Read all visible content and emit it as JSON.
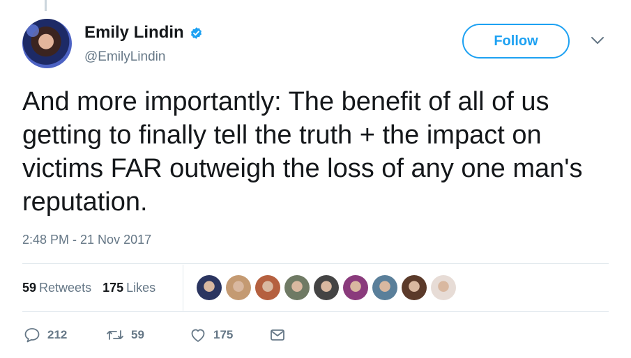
{
  "author": {
    "display_name": "Emily Lindin",
    "handle": "@EmilyLindin",
    "avatar_icon": "profile-photo",
    "verified_icon": "verified-badge-icon",
    "verified_color": "#1da1f2"
  },
  "follow_button": {
    "label": "Follow",
    "color": "#1da1f2"
  },
  "tweet": {
    "text": "And more importantly: The benefit of all of us getting to finally tell the truth + the impact on victims FAR outweigh the loss of any one man's reputation.",
    "timestamp": "2:48 PM - 21 Nov 2017"
  },
  "stats": {
    "retweets_count": "59",
    "retweets_label": "Retweets",
    "likes_count": "175",
    "likes_label": "Likes"
  },
  "liker_avatars": [
    {
      "icon": "liker-avatar",
      "color": "#2b3560"
    },
    {
      "icon": "liker-avatar",
      "color": "#c49a72"
    },
    {
      "icon": "liker-avatar",
      "color": "#b5603f"
    },
    {
      "icon": "liker-avatar",
      "color": "#6f7a64"
    },
    {
      "icon": "liker-avatar",
      "color": "#444444"
    },
    {
      "icon": "liker-avatar",
      "color": "#8a3b7c"
    },
    {
      "icon": "liker-avatar",
      "color": "#5a7f9a"
    },
    {
      "icon": "liker-avatar",
      "color": "#5b3a2a"
    },
    {
      "icon": "liker-avatar",
      "color": "#e7dcd6"
    }
  ],
  "actions": {
    "reply_count": "212",
    "retweet_count": "59",
    "like_count": "175",
    "icons": [
      "reply-icon",
      "retweet-icon",
      "like-icon",
      "direct-message-icon"
    ],
    "icon_color": "#657786"
  }
}
